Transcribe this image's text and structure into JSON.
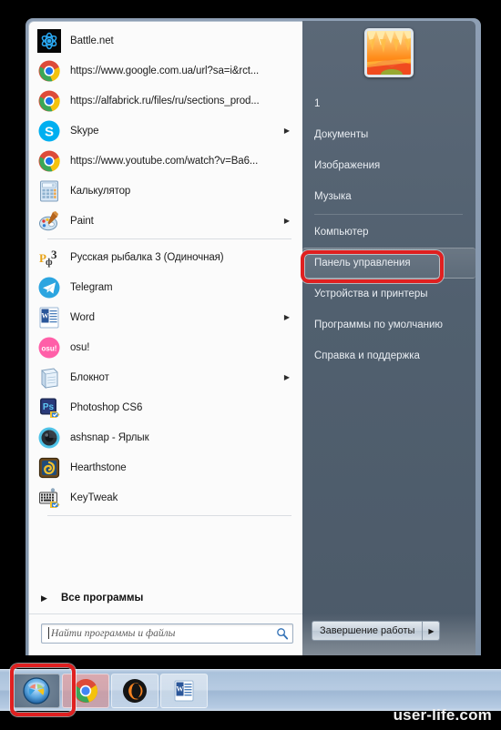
{
  "menu": {
    "left": {
      "programs": [
        {
          "label": "Battle.net",
          "icon": "battlenet-icon",
          "arrow": false,
          "sep_after": false
        },
        {
          "label": "https://www.google.com.ua/url?sa=i&rct...",
          "icon": "chrome-icon",
          "arrow": false,
          "sep_after": false
        },
        {
          "label": "https://alfabrick.ru/files/ru/sections_prod...",
          "icon": "chrome-icon",
          "arrow": false,
          "sep_after": false
        },
        {
          "label": "Skype",
          "icon": "skype-icon",
          "arrow": true,
          "sep_after": false
        },
        {
          "label": "https://www.youtube.com/watch?v=Ba6...",
          "icon": "chrome-icon",
          "arrow": false,
          "sep_after": false
        },
        {
          "label": "Калькулятор",
          "icon": "calculator-icon",
          "arrow": false,
          "sep_after": false
        },
        {
          "label": "Paint",
          "icon": "paint-icon",
          "arrow": true,
          "sep_after": true
        },
        {
          "label": "Русская рыбалка 3 (Одиночная)",
          "icon": "fishing-icon",
          "arrow": false,
          "sep_after": false
        },
        {
          "label": "Telegram",
          "icon": "telegram-icon",
          "arrow": false,
          "sep_after": false
        },
        {
          "label": "Word",
          "icon": "word-icon",
          "arrow": true,
          "sep_after": false
        },
        {
          "label": "osu!",
          "icon": "osu-icon",
          "arrow": false,
          "sep_after": false
        },
        {
          "label": "Блокнот",
          "icon": "notepad-icon",
          "arrow": true,
          "sep_after": false
        },
        {
          "label": "Photoshop CS6",
          "icon": "photoshop-icon",
          "arrow": false,
          "sep_after": false
        },
        {
          "label": "ashsnap - Ярлык",
          "icon": "ashsnap-icon",
          "arrow": false,
          "sep_after": false
        },
        {
          "label": "Hearthstone",
          "icon": "hearthstone-icon",
          "arrow": false,
          "sep_after": false
        },
        {
          "label": "KeyTweak",
          "icon": "keytweak-icon",
          "arrow": false,
          "sep_after": true
        }
      ],
      "all_programs": {
        "label": "Все программы",
        "arrow_icon": "triangle-right-icon"
      },
      "search": {
        "placeholder": "Найти программы и файлы",
        "value": "",
        "icon": "search-icon"
      }
    },
    "right": {
      "avatar_name": "user-avatar",
      "user_name": "1",
      "items": [
        {
          "label": "Документы",
          "active": false,
          "sep_after": false
        },
        {
          "label": "Изображения",
          "active": false,
          "sep_after": false
        },
        {
          "label": "Музыка",
          "active": false,
          "sep_after": true
        },
        {
          "label": "Компьютер",
          "active": false,
          "sep_after": false
        },
        {
          "label": "Панель управления",
          "active": true,
          "sep_after": false
        },
        {
          "label": "Устройства и принтеры",
          "active": false,
          "sep_after": false
        },
        {
          "label": "Программы по умолчанию",
          "active": false,
          "sep_after": false
        },
        {
          "label": "Справка и поддержка",
          "active": false,
          "sep_after": false
        }
      ],
      "shutdown": {
        "label": "Завершение работы",
        "arrow_icon": "triangle-right-icon"
      }
    }
  },
  "taskbar": {
    "buttons": [
      {
        "name": "start-orb-button",
        "icon": "windows-orb-icon"
      },
      {
        "name": "chrome-taskbar-button",
        "icon": "chrome-icon"
      },
      {
        "name": "opera-taskbar-button",
        "icon": "opera-icon"
      },
      {
        "name": "word-taskbar-button",
        "icon": "word-icon"
      }
    ]
  },
  "annotations": {
    "highlight_color": "#e02020",
    "boxes": [
      {
        "name": "control-panel-highlight",
        "target": "Панель управления"
      },
      {
        "name": "start-orb-highlight",
        "target": "Start"
      }
    ]
  },
  "watermark": {
    "text": "user-life.com"
  }
}
